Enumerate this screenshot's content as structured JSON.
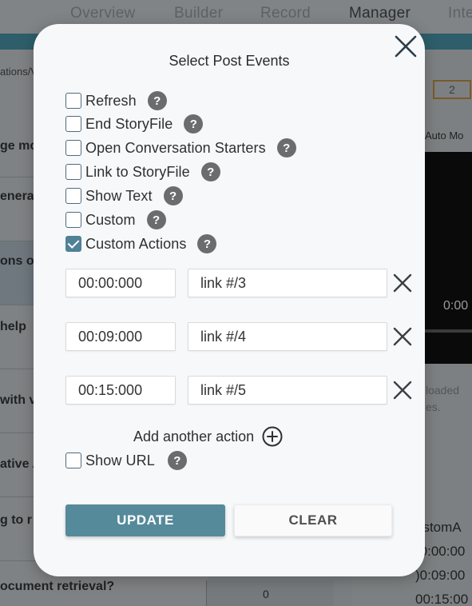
{
  "background": {
    "tabs": [
      "Overview",
      "Builder",
      "Record",
      "Manager",
      "Inte"
    ],
    "active_tab": "Manager",
    "breadcrumb": "ations/V",
    "list_rows": [
      "ge mo",
      "enera",
      "ons of",
      " help",
      "with v",
      "ative A",
      "g to r"
    ],
    "bottom_row": "ocument retrieval?",
    "stepper_value": "0",
    "page_count": "2",
    "auto_mode": "Auto Mo",
    "video_time": "0:00",
    "loaded_text": [
      "loaded",
      "es."
    ],
    "custom_heading": "ustomA",
    "custom_times": [
      ")0:00:00",
      ")0:09:00",
      "00:15:00"
    ]
  },
  "modal": {
    "title": "Select Post Events",
    "close_icon": "close-x-icon",
    "options": [
      {
        "label": "Refresh",
        "checked": false
      },
      {
        "label": "End StoryFile",
        "checked": false
      },
      {
        "label": "Open Conversation Starters",
        "checked": false
      },
      {
        "label": "Link to StoryFile",
        "checked": false
      },
      {
        "label": "Show Text",
        "checked": false
      },
      {
        "label": "Custom",
        "checked": false
      },
      {
        "label": "Custom Actions",
        "checked": true
      }
    ],
    "help_glyph": "?",
    "actions": [
      {
        "time": "00:00:000",
        "link": "link #/3"
      },
      {
        "time": "00:09:000",
        "link": "link #/4"
      },
      {
        "time": "00:15:000",
        "link": "link #/5"
      }
    ],
    "add_action_label": "Add another action",
    "show_url": {
      "label": "Show URL",
      "checked": false
    },
    "update_label": "UPDATE",
    "clear_label": "CLEAR"
  },
  "colors": {
    "accent": "#558a9b",
    "checked": "#4f8296",
    "help_badge": "#6a6d70",
    "overlay": "#7b7e80"
  }
}
